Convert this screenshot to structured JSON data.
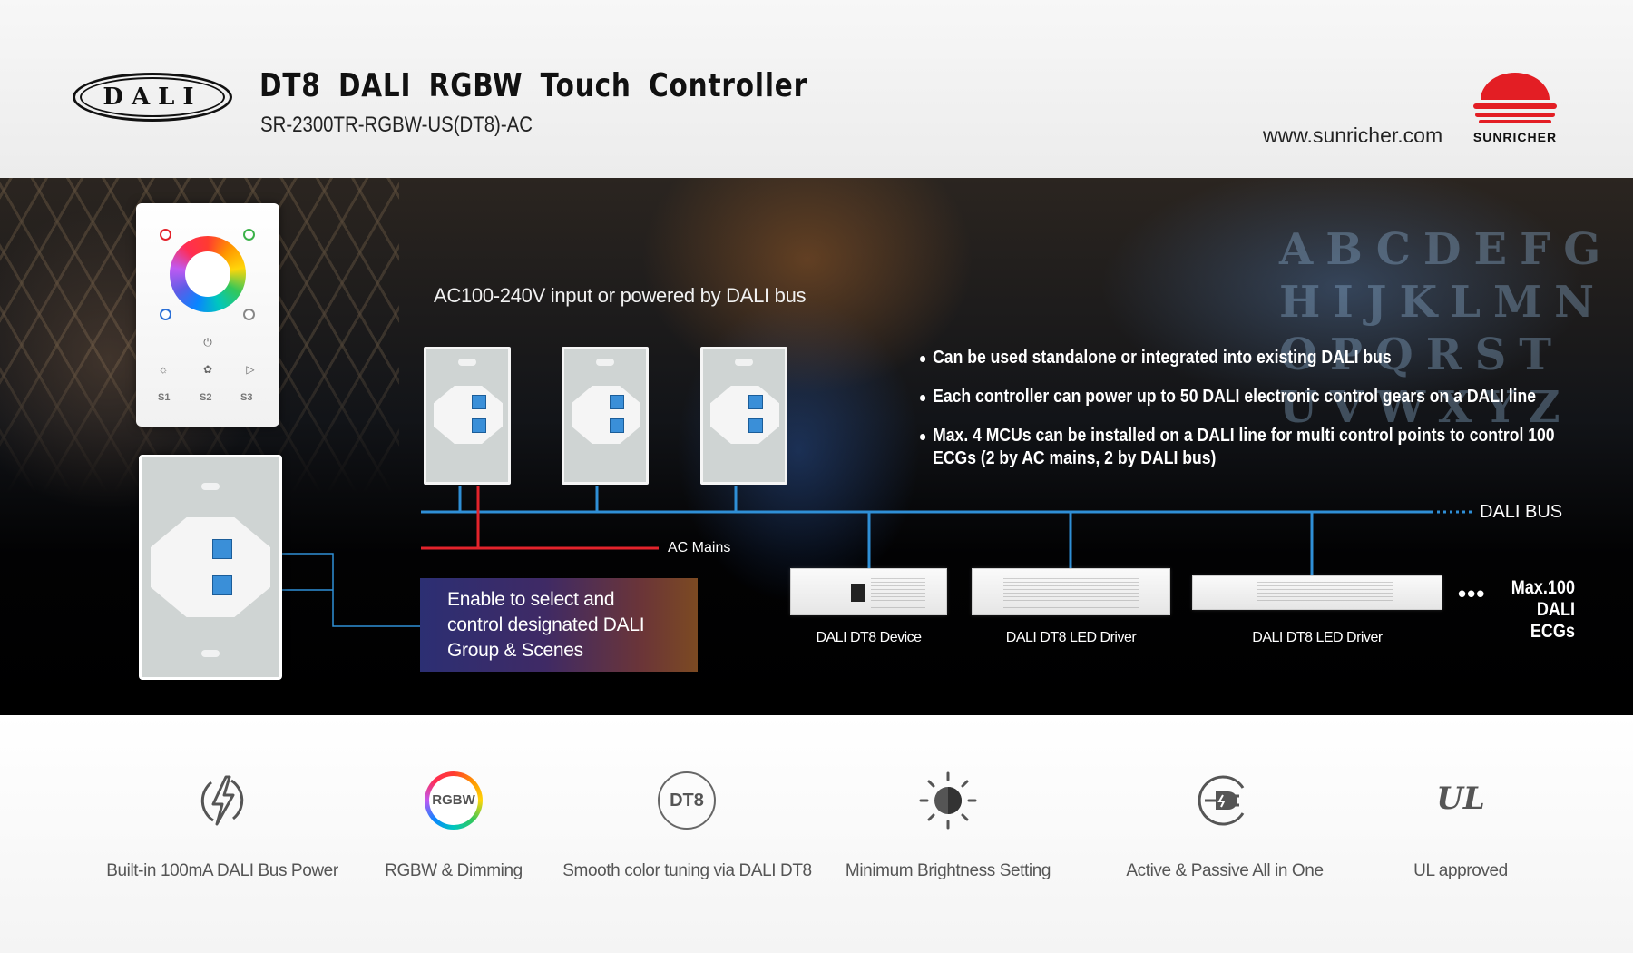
{
  "header": {
    "logo_text": "DALI",
    "title": "DT8 DALI RGBW Touch Controller",
    "model": "SR-2300TR-RGBW-US(DT8)-AC",
    "website": "www.sunricher.com",
    "brand": "SUNRICHER"
  },
  "diagram": {
    "power_heading": "AC100-240V input or powered by DALI bus",
    "bullets": [
      "Can be used standalone or integrated into existing DALI bus",
      "Each controller can power up to 50 DALI electronic control gears on a DALI line",
      "Max. 4 MCUs can be installed on a DALI line for multi control points to control 100 ECGs (2 by AC mains, 2 by DALI bus)"
    ],
    "dali_bus_label": "DALI BUS",
    "ac_mains_label": "AC Mains",
    "panel_buttons": [
      "S1",
      "S2",
      "S3"
    ],
    "info_box": "Enable to select and control designated DALI Group & Scenes",
    "devices": [
      {
        "caption": "DALI DT8 Device"
      },
      {
        "caption": "DALI DT8 LED Driver"
      },
      {
        "caption": "DALI DT8 LED Driver"
      }
    ],
    "ellipsis": "•••",
    "max_label_line1": "Max.100",
    "max_label_line2": "DALI ECGs",
    "background_letters": [
      "ABCDEFG",
      "HIJKLMN",
      "OPQRST",
      "UVWXYZ"
    ],
    "colors": {
      "dali_bus_line": "#2f8fd6",
      "ac_mains_line": "#e3232b"
    }
  },
  "features": [
    {
      "icon": "lightning-icon",
      "label": "Built-in 100mA DALI Bus Power"
    },
    {
      "icon": "rgbw-ring-icon",
      "icon_text": "RGBW",
      "label": "RGBW & Dimming"
    },
    {
      "icon": "dt8-icon",
      "icon_text": "DT8",
      "label": "Smooth color tuning via DALI DT8"
    },
    {
      "icon": "sun-icon",
      "label": "Minimum Brightness Setting"
    },
    {
      "icon": "plug-icon",
      "label": "Active & Passive All in One"
    },
    {
      "icon": "ul-icon",
      "icon_text": "UL",
      "label": "UL approved"
    }
  ]
}
